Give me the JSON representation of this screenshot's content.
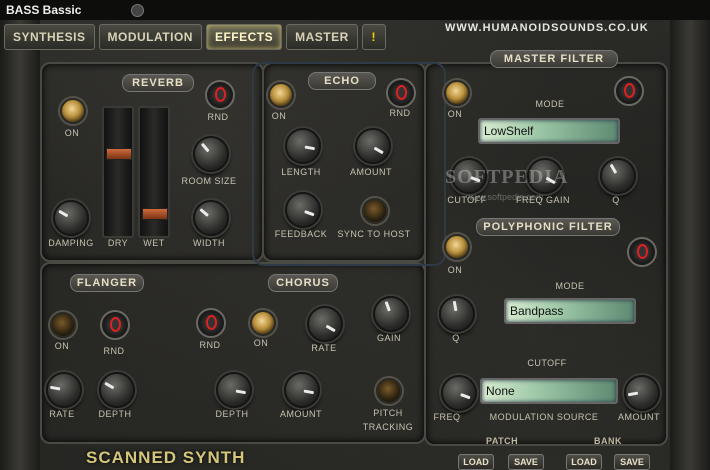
{
  "window": {
    "title": "BASS Bassic"
  },
  "tabs": [
    {
      "label": "SYNTHESIS"
    },
    {
      "label": "MODULATION"
    },
    {
      "label": "EFFECTS"
    },
    {
      "label": "MASTER"
    },
    {
      "label": "!"
    }
  ],
  "site": "WWW.HUMANOIDSOUNDS.CO.UK",
  "reverb": {
    "title": "REVERB",
    "on": "ON",
    "rnd": "RND",
    "room_size": "ROOM SIZE",
    "width": "WIDTH",
    "damping": "DAMPING",
    "dry": "DRY",
    "wet": "WET"
  },
  "echo": {
    "title": "ECHO",
    "on": "ON",
    "rnd": "RND",
    "length": "LENGTH",
    "amount": "AMOUNT",
    "feedback": "FEEDBACK",
    "sync": "SYNC TO HOST"
  },
  "master_filter": {
    "title": "MASTER FILTER",
    "on": "ON",
    "mode_label": "MODE",
    "mode_value": "LowShelf",
    "cutoff": "CUTOFF",
    "freq_gain": "FREQ GAIN",
    "q": "Q"
  },
  "poly_filter": {
    "title": "POLYPHONIC FILTER",
    "on": "ON",
    "mode_label": "MODE",
    "mode_value": "Bandpass",
    "gain": "GAIN",
    "q": "Q",
    "cutoff": "CUTOFF",
    "freq": "FREQ",
    "mod_source_label": "MODULATION SOURCE",
    "mod_source_value": "None",
    "amount": "AMOUNT"
  },
  "flanger": {
    "title": "FLANGER",
    "on": "ON",
    "rnd": "RND",
    "rate": "RATE",
    "depth": "DEPTH"
  },
  "chorus": {
    "title": "CHORUS",
    "rnd": "RND",
    "on": "ON",
    "rate": "RATE",
    "depth": "DEPTH",
    "amount": "AMOUNT"
  },
  "pitch_tracking": {
    "line1": "PITCH",
    "line2": "TRACKING"
  },
  "patch": {
    "label": "PATCH",
    "load": "LOAD",
    "save": "SAVE"
  },
  "bank": {
    "label": "BANK",
    "load": "LOAD",
    "save": "SAVE"
  },
  "footer": "SCANNED SYNTH",
  "watermark": {
    "text": "SOFTPEDIA",
    "url": "www.softpedia.com"
  }
}
